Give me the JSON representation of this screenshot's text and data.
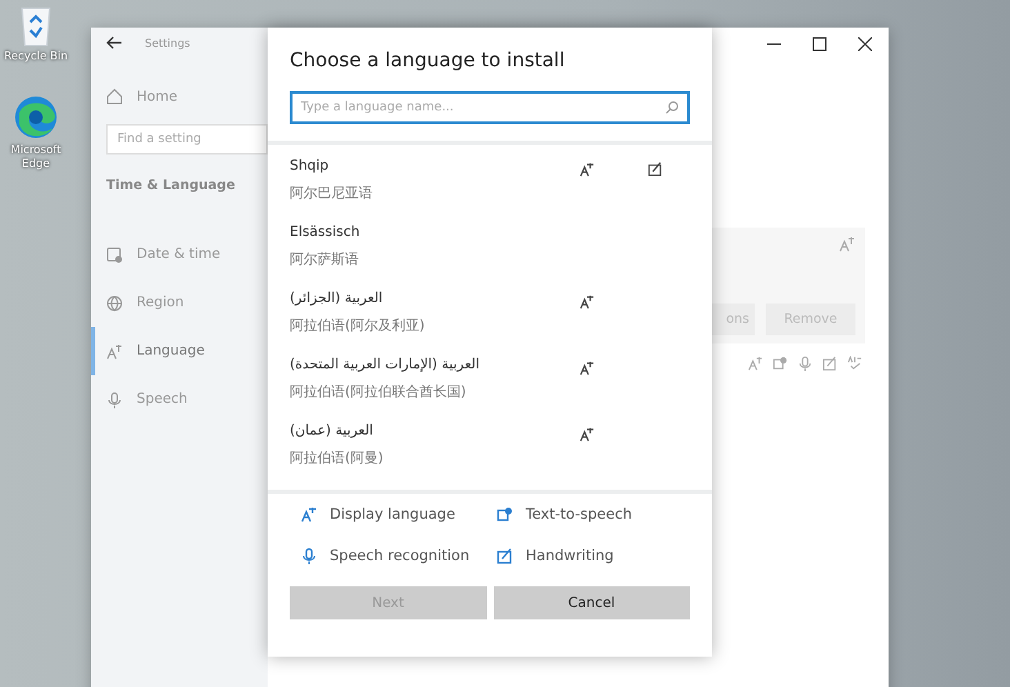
{
  "desktop_icons": [
    {
      "label": "Recycle Bin",
      "kind": "recycle"
    },
    {
      "label": "Microsoft Edge",
      "kind": "edge"
    }
  ],
  "settings": {
    "title": "Settings",
    "home": "Home",
    "search_placeholder": "Find a setting",
    "section": "Time & Language",
    "nav": [
      {
        "label": "Date & time",
        "kind": "clock",
        "selected": false
      },
      {
        "label": "Region",
        "kind": "globe",
        "selected": false
      },
      {
        "label": "Language",
        "kind": "language",
        "selected": true
      },
      {
        "label": "Speech",
        "kind": "mic",
        "selected": false
      }
    ],
    "card_buttons": [
      {
        "label": "ons"
      },
      {
        "label": "Remove"
      }
    ]
  },
  "dialog": {
    "title": "Choose a language to install",
    "search_placeholder": "Type a language name...",
    "languages": [
      {
        "name": "Shqip",
        "native": "阿尔巴尼亚语",
        "display_language": true,
        "handwriting": true
      },
      {
        "name": "Elsässisch",
        "native": "阿尔萨斯语",
        "display_language": false,
        "handwriting": false
      },
      {
        "name": "العربية (الجزائر)",
        "native": "阿拉伯语(阿尔及利亚)",
        "display_language": true,
        "handwriting": false
      },
      {
        "name": "العربية (الإمارات العربية المتحدة)",
        "native": "阿拉伯语(阿拉伯联合酋长国)",
        "display_language": true,
        "handwriting": false
      },
      {
        "name": "العربية (عمان)",
        "native": "阿拉伯语(阿曼)",
        "display_language": true,
        "handwriting": false
      }
    ],
    "legend": [
      {
        "label": "Display language",
        "kind": "display"
      },
      {
        "label": "Text-to-speech",
        "kind": "tts"
      },
      {
        "label": "Speech recognition",
        "kind": "speech"
      },
      {
        "label": "Handwriting",
        "kind": "handwriting"
      }
    ],
    "buttons": [
      {
        "label": "Next",
        "disabled": true
      },
      {
        "label": "Cancel",
        "disabled": false
      }
    ]
  }
}
